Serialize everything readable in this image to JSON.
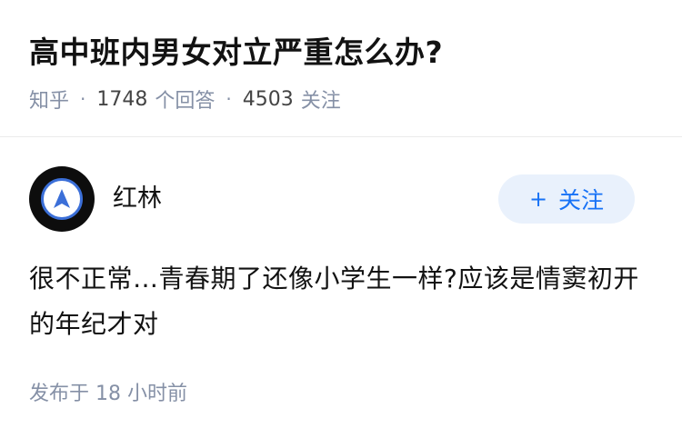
{
  "question": {
    "title": "高中班内男女对立严重怎么办?",
    "source": "知乎",
    "separator": "·",
    "answers_count": "1748",
    "answers_label": "个回答",
    "followers_count": "4503",
    "followers_label": "关注"
  },
  "answer": {
    "author": {
      "name": "红林",
      "avatar_icon": "blue-arrow-compass-icon"
    },
    "follow_button": {
      "plus": "+",
      "label": "关注"
    },
    "content": "很不正常…青春期了还像小学生一样?应该是情窦初开的年纪才对",
    "published_time": "发布于 18 小时前"
  },
  "colors": {
    "title": "#121212",
    "meta": "#8590a6",
    "accent": "#1772f6",
    "follow_bg": "#e9f1fc",
    "divider": "#ebebeb"
  }
}
